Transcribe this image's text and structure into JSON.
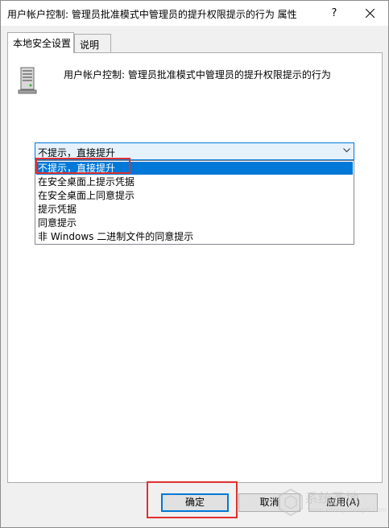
{
  "window": {
    "title": "用户帐户控制: 管理员批准模式中管理员的提升权限提示的行为 属性",
    "help_label": "?"
  },
  "tabs": [
    {
      "label": "本地安全设置",
      "active": true
    },
    {
      "label": "说明",
      "active": false
    }
  ],
  "policy": {
    "name": "用户帐户控制: 管理员批准模式中管理员的提升权限提示的行为",
    "icon": "server-computer-icon"
  },
  "combo": {
    "selected_value": "不提示，直接提升"
  },
  "dropdown": {
    "options": [
      "不提示，直接提升",
      "在安全桌面上提示凭据",
      "在安全桌面上同意提示",
      "提示凭据",
      "同意提示",
      "非 Windows 二进制文件的同意提示"
    ],
    "highlighted_index": 0
  },
  "buttons": {
    "ok": "确定",
    "cancel": "取消",
    "apply": "应用(A)"
  },
  "watermark": {
    "text": "系统圣地",
    "sub": "www.xitongshengdi.com"
  },
  "colors": {
    "accent": "#0078d7",
    "annotation": "#e03030"
  }
}
